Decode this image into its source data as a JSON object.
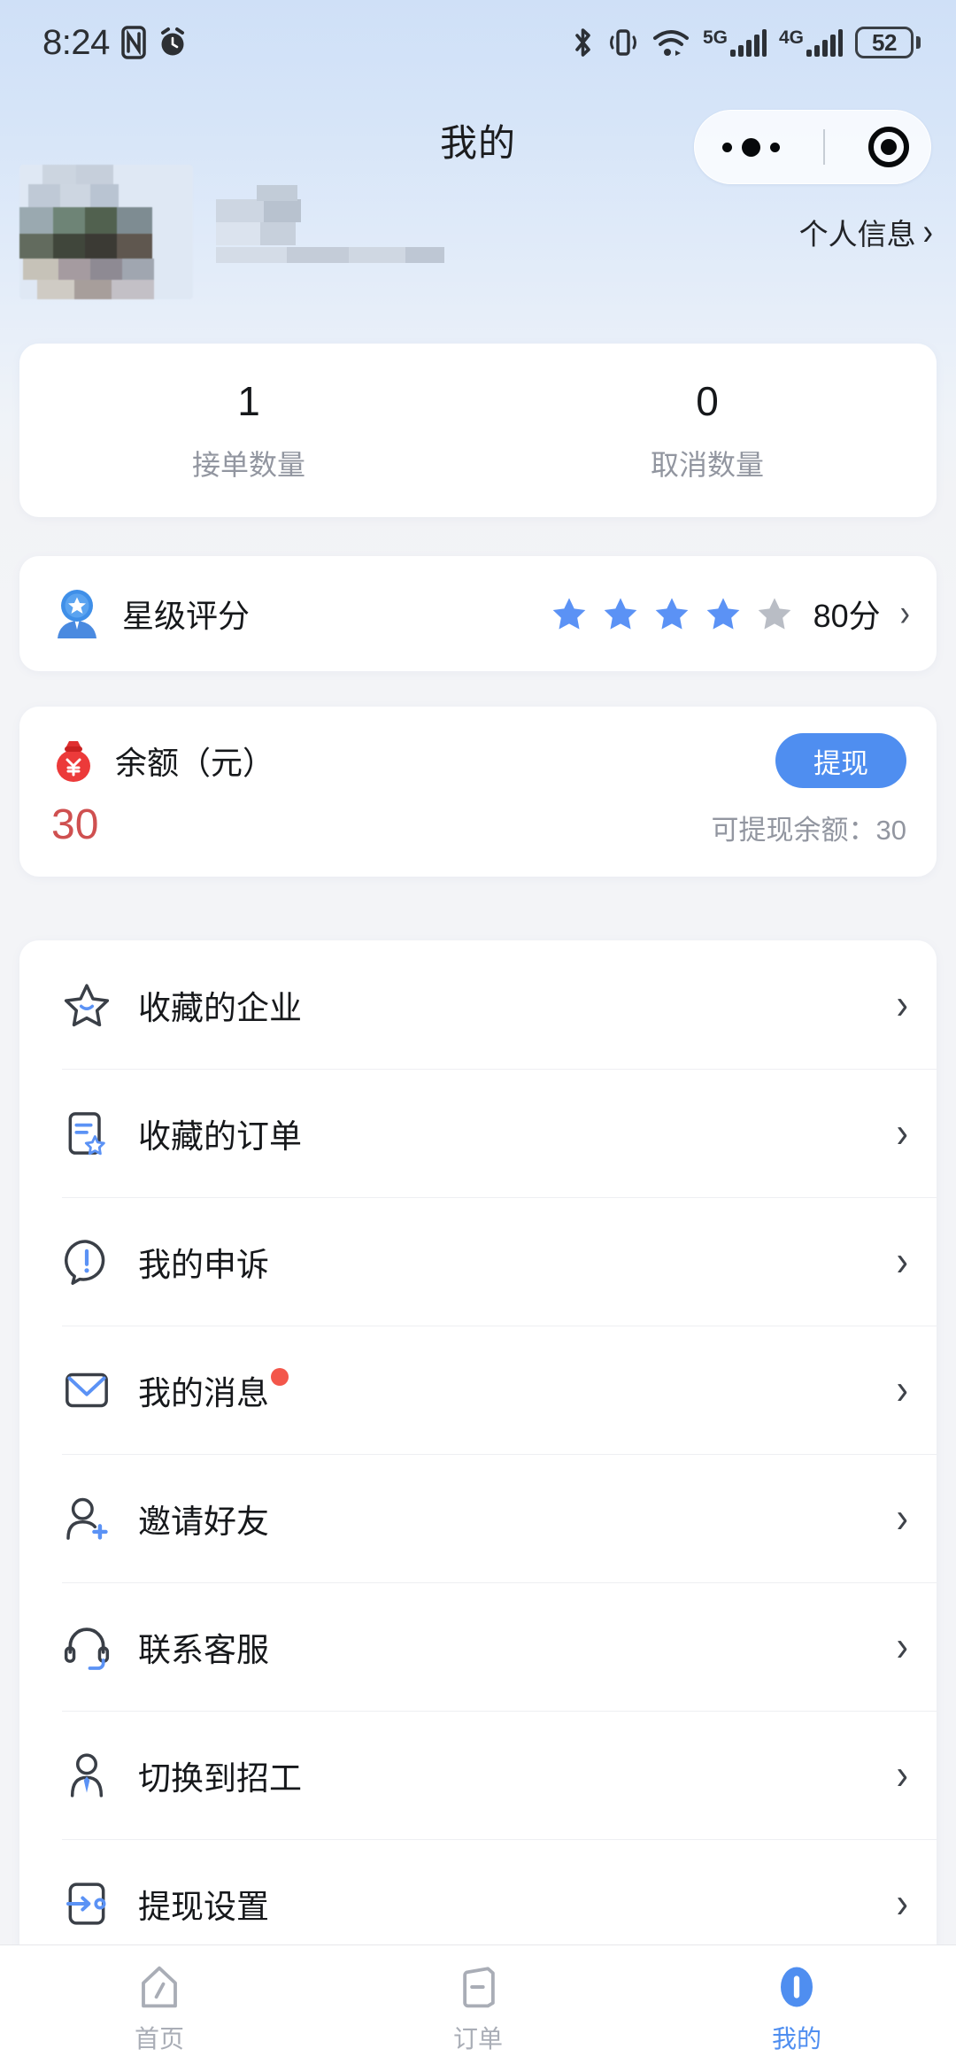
{
  "status_bar": {
    "time": "8:24",
    "left_icons": [
      "nfc-icon",
      "alarm-icon"
    ],
    "right_icons": [
      "bluetooth-icon",
      "vibrate-icon",
      "wifi-icon",
      "signal-5g-icon",
      "signal-4g-icon"
    ],
    "network_5g_label": "5G",
    "network_4g_label": "4G",
    "battery_percent": "52"
  },
  "header": {
    "title": "我的",
    "capsule": {
      "more_icon": "more-dots-icon",
      "close_icon": "target-circle-icon"
    },
    "personal_info_label": "个人信息",
    "personal_info_chevron": "›",
    "avatar": "user-avatar-blurred",
    "username": "username-blurred"
  },
  "stats": {
    "items": [
      {
        "value": "1",
        "label": "接单数量"
      },
      {
        "value": "0",
        "label": "取消数量"
      }
    ]
  },
  "rating": {
    "icon": "rating-badge-user-icon",
    "title": "星级评分",
    "stars_total": 5,
    "stars_filled": 4,
    "score": "80分",
    "chevron": "›",
    "star_active_color": "#5b92f5",
    "star_inactive_color": "#b9bdc5"
  },
  "balance": {
    "icon": "money-bag-icon",
    "title": "余额（元）",
    "withdraw_label": "提现",
    "amount": "30",
    "available_label": "可提现余额：30",
    "amount_color": "#cf5050",
    "button_color": "#4f8ef0"
  },
  "menu": {
    "items": [
      {
        "icon": "star-outline-icon",
        "label": "收藏的企业",
        "chevron": "›",
        "badge": false
      },
      {
        "icon": "doc-star-icon",
        "label": "收藏的订单",
        "chevron": "›",
        "badge": false
      },
      {
        "icon": "exclamation-bubble-icon",
        "label": "我的申诉",
        "chevron": "›",
        "badge": false
      },
      {
        "icon": "envelope-icon",
        "label": "我的消息",
        "chevron": "›",
        "badge": true
      },
      {
        "icon": "user-plus-icon",
        "label": "邀请好友",
        "chevron": "›",
        "badge": false
      },
      {
        "icon": "headset-icon",
        "label": "联系客服",
        "chevron": "›",
        "badge": false
      },
      {
        "icon": "user-tie-icon",
        "label": "切换到招工",
        "chevron": "›",
        "badge": false
      },
      {
        "icon": "withdraw-settings-icon",
        "label": "提现设置",
        "chevron": "›",
        "badge": false
      }
    ]
  },
  "tabbar": {
    "active_color": "#4f8ef0",
    "inactive_color": "#a9adb6",
    "tabs": [
      {
        "icon": "home-icon",
        "label": "首页",
        "active": false
      },
      {
        "icon": "order-icon",
        "label": "订单",
        "active": false
      },
      {
        "icon": "mine-icon",
        "label": "我的",
        "active": true
      }
    ]
  }
}
